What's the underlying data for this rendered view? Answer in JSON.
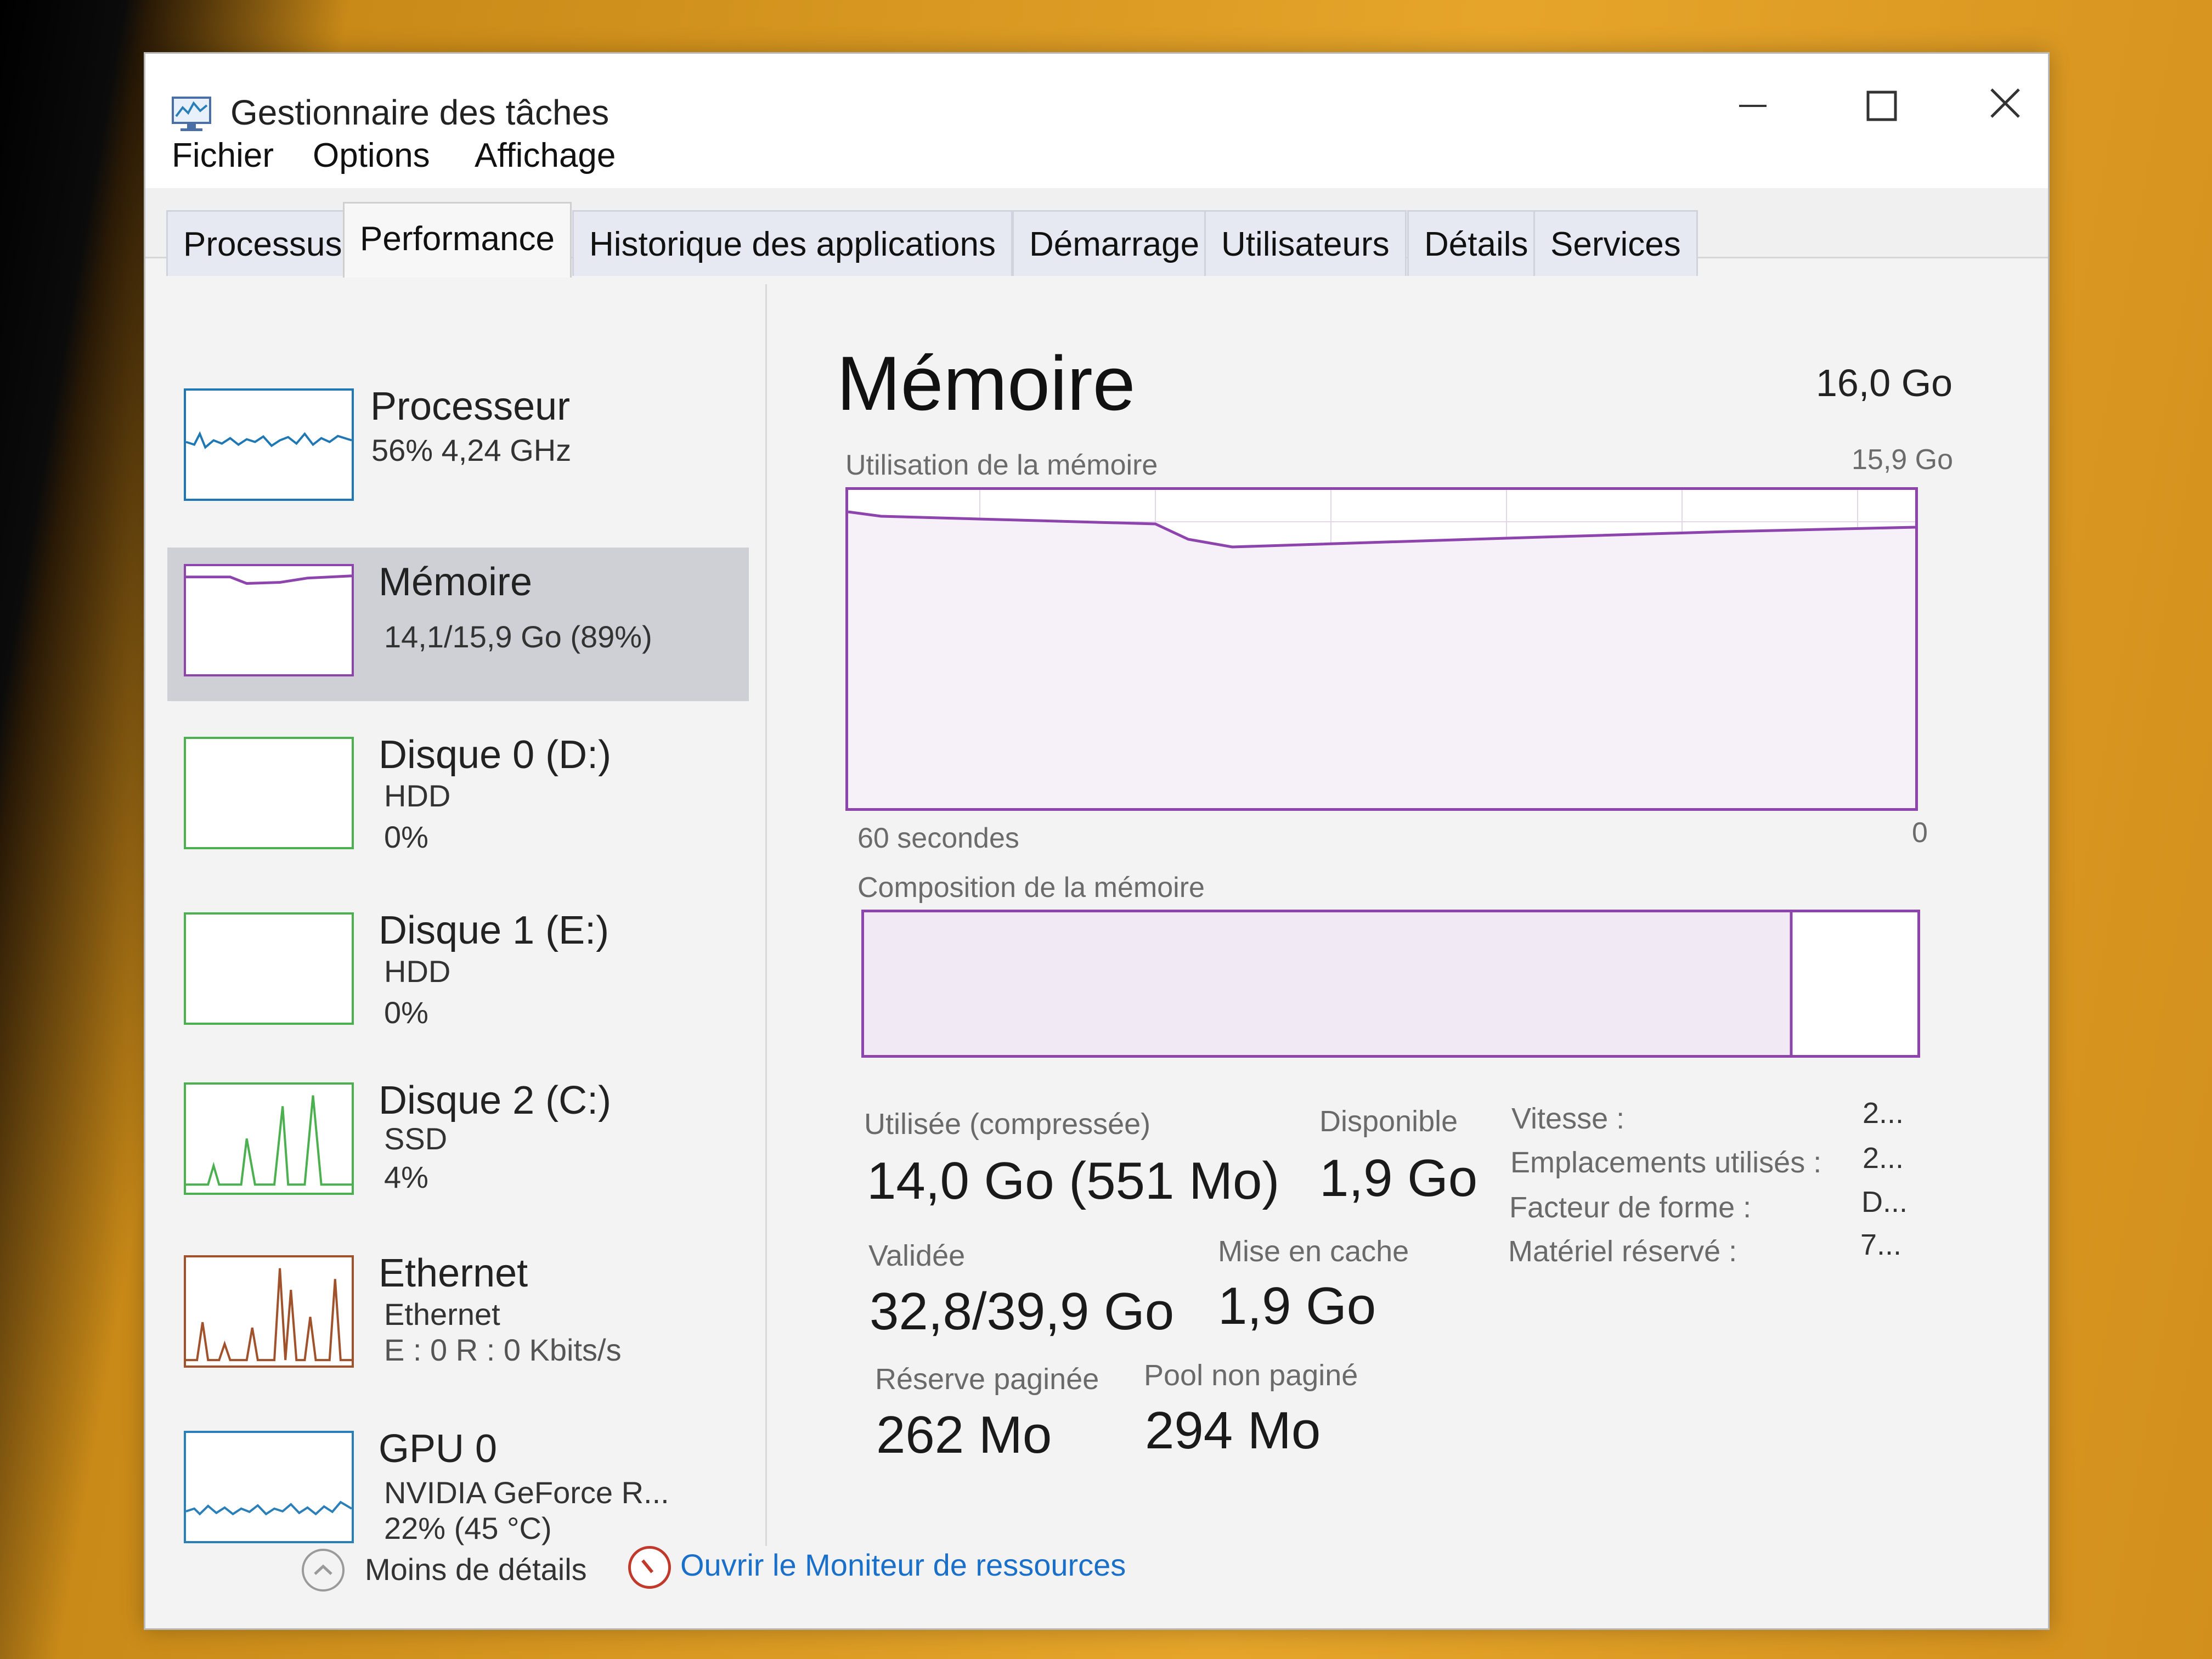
{
  "window": {
    "title": "Gestionnaire des tâches"
  },
  "menu": {
    "items": [
      "Fichier",
      "Options",
      "Affichage"
    ]
  },
  "tabs": [
    "Processus",
    "Performance",
    "Historique des applications",
    "Démarrage",
    "Utilisateurs",
    "Détails",
    "Services"
  ],
  "active_tab": "Performance",
  "sidebar": {
    "items": [
      {
        "title": "Processeur",
        "sub1": "56% 4,24 GHz",
        "sub2": ""
      },
      {
        "title": "Mémoire",
        "sub1": "14,1/15,9 Go (89%)",
        "sub2": ""
      },
      {
        "title": "Disque 0 (D:)",
        "sub1": "HDD",
        "sub2": "0%"
      },
      {
        "title": "Disque 1 (E:)",
        "sub1": "HDD",
        "sub2": "0%"
      },
      {
        "title": "Disque 2 (C:)",
        "sub1": "SSD",
        "sub2": "4%"
      },
      {
        "title": "Ethernet",
        "sub1": "Ethernet",
        "sub2": "E : 0 R : 0 Kbits/s"
      },
      {
        "title": "GPU 0",
        "sub1": "NVIDIA GeForce R...",
        "sub2": "22% (45 °C)"
      }
    ],
    "selected_index": 1
  },
  "main": {
    "title": "Mémoire",
    "total": "16,0 Go",
    "usage_label": "Utilisation de la mémoire",
    "usage_max": "15,9 Go",
    "time_left": "60 secondes",
    "time_right": "0",
    "composition_label": "Composition de la mémoire",
    "composition_used_fraction": 0.88
  },
  "stats": {
    "used_label": "Utilisée (compressée)",
    "used_value": "14,0 Go (551 Mo)",
    "available_label": "Disponible",
    "available_value": "1,9 Go",
    "committed_label": "Validée",
    "committed_value": "32,8/39,9 Go",
    "cached_label": "Mise en cache",
    "cached_value": "1,9 Go",
    "paged_label": "Réserve paginée",
    "paged_value": "262 Mo",
    "nonpaged_label": "Pool non paginé",
    "nonpaged_value": "294 Mo"
  },
  "details": [
    {
      "key": "Vitesse :",
      "value": "2..."
    },
    {
      "key": "Emplacements utilisés :",
      "value": "2..."
    },
    {
      "key": "Facteur de forme :",
      "value": "D..."
    },
    {
      "key": "Matériel réservé :",
      "value": "7..."
    }
  ],
  "footer": {
    "less_details": "Moins de détails",
    "resource_monitor": "Ouvrir le Moniteur de ressources"
  },
  "colors": {
    "memory": "#8e44ad",
    "cpu": "#1f77b4",
    "disk": "#4caf50",
    "ethernet": "#a0522d",
    "gpu": "#2b7fb8",
    "link": "#1a6fc9"
  }
}
